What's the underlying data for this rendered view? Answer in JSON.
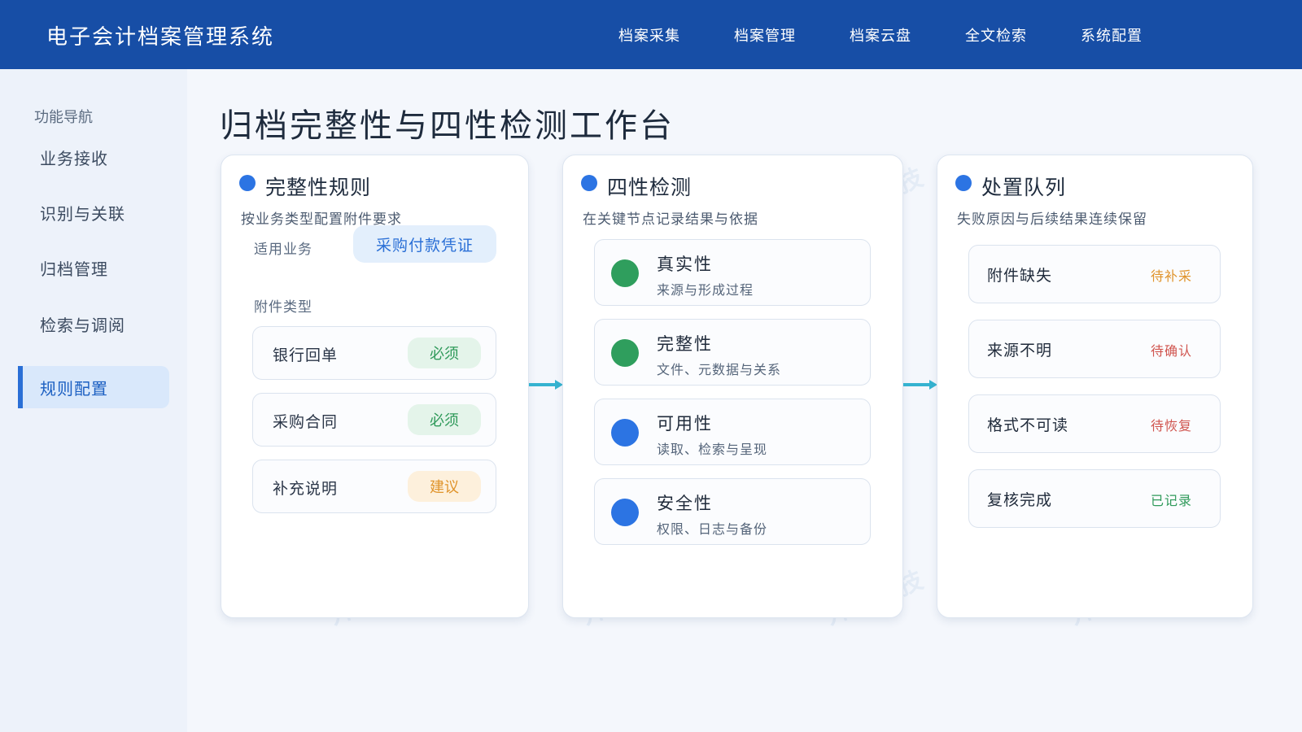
{
  "app": {
    "title": "电子会计档案管理系统"
  },
  "topnav": [
    "档案采集",
    "档案管理",
    "档案云盘",
    "全文检索",
    "系统配置"
  ],
  "sidebar": {
    "heading": "功能导航",
    "items": [
      {
        "label": "业务接收",
        "active": false
      },
      {
        "label": "识别与关联",
        "active": false
      },
      {
        "label": "归档管理",
        "active": false
      },
      {
        "label": "检索与调阅",
        "active": false
      },
      {
        "label": "规则配置",
        "active": true
      }
    ]
  },
  "page": {
    "title": "归档完整性与四性检测工作台"
  },
  "rules_panel": {
    "title": "完整性规则",
    "subtitle": "按业务类型配置附件要求",
    "business_label": "适用业务",
    "business_value": "采购付款凭证",
    "attachment_label": "附件类型",
    "attachments": [
      {
        "name": "银行回单",
        "requirement": "必须"
      },
      {
        "name": "采购合同",
        "requirement": "必须"
      },
      {
        "name": "补充说明",
        "requirement": "建议"
      }
    ]
  },
  "check_panel": {
    "title": "四性检测",
    "subtitle": "在关键节点记录结果与依据",
    "checks": [
      {
        "name": "真实性",
        "desc": "来源与形成过程",
        "color": "#2f9e5d"
      },
      {
        "name": "完整性",
        "desc": "文件、元数据与关系",
        "color": "#2f9e5d"
      },
      {
        "name": "可用性",
        "desc": "读取、检索与呈现",
        "color": "#2c74e3"
      },
      {
        "name": "安全性",
        "desc": "权限、日志与备份",
        "color": "#2c74e3"
      }
    ]
  },
  "queue_panel": {
    "title": "处置队列",
    "subtitle": "失败原因与后续结果连续保留",
    "items": [
      {
        "name": "附件缺失",
        "status": "待补采",
        "color": "#e0942c"
      },
      {
        "name": "来源不明",
        "status": "待确认",
        "color": "#d0554f"
      },
      {
        "name": "格式不可读",
        "status": "待恢复",
        "color": "#d0554f"
      },
      {
        "name": "复核完成",
        "status": "已记录",
        "color": "#2f9a5a"
      }
    ]
  },
  "watermark": {
    "text": "开灵科技"
  },
  "colors": {
    "header": "#174ea6",
    "accent": "#2c74e3",
    "arrow": "#35b3d0"
  }
}
